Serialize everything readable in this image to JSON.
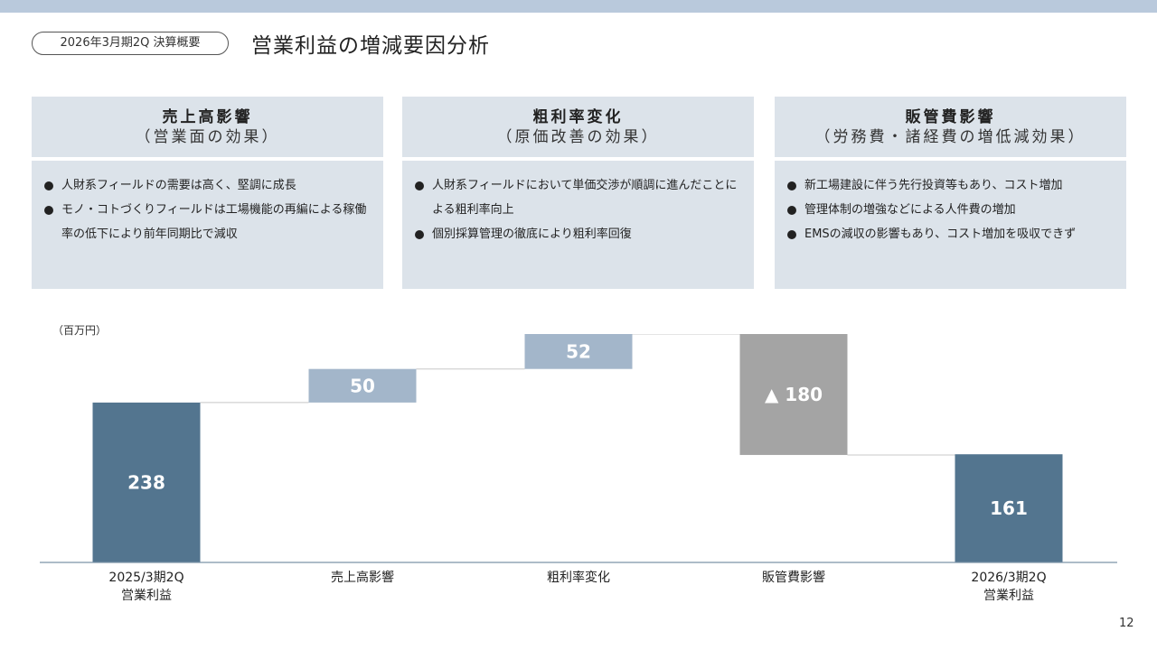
{
  "header": {
    "period_label": "2026年3月期2Q 決算概要",
    "title": "営業利益の増減要因分析"
  },
  "boxes": [
    {
      "title": "売上高影響",
      "subtitle": "（営業面の効果）",
      "bullets": [
        "人財系フィールドの需要は高く、堅調に成長",
        "モノ・コトづくりフィールドは工場機能の再編による稼働率の低下により前年同期比で減収"
      ]
    },
    {
      "title": "粗利率変化",
      "subtitle": "（原価改善の効果）",
      "bullets": [
        "人財系フィールドにおいて単価交渉が順調に進んだことによる粗利率向上",
        "個別採算管理の徹底により粗利率回復"
      ]
    },
    {
      "title": "販管費影響",
      "subtitle": "（労務費・諸経費の増低減効果）",
      "bullets": [
        "新工場建設に伴う先行投資等もあり、コスト増加",
        "管理体制の増強などによる人件費の増加",
        "EMSの減収の影響もあり、コスト増加を吸収できず"
      ]
    }
  ],
  "chart_unit": "（百万円）",
  "page_number": "12",
  "colors": {
    "total": "#53758f",
    "increase": "#a3b6ca",
    "decrease": "#a4a4a4",
    "axis": "#7c93a8"
  },
  "chart_data": {
    "type": "bar",
    "subtype": "waterfall",
    "unit": "（百万円）",
    "categories": [
      [
        "2025/3期2Q",
        "営業利益"
      ],
      [
        "売上高影響"
      ],
      [
        "粗利率変化"
      ],
      [
        "販管費影響"
      ],
      [
        "2026/3期2Q",
        "営業利益"
      ]
    ],
    "values": [
      238,
      50,
      52,
      -180,
      161
    ],
    "kinds": [
      "total",
      "increase",
      "increase",
      "decrease",
      "total"
    ],
    "labels": [
      "238",
      "50",
      "52",
      "▲ 180",
      "161"
    ],
    "ylim": [
      0,
      340
    ],
    "grid": false,
    "legend": "none"
  }
}
